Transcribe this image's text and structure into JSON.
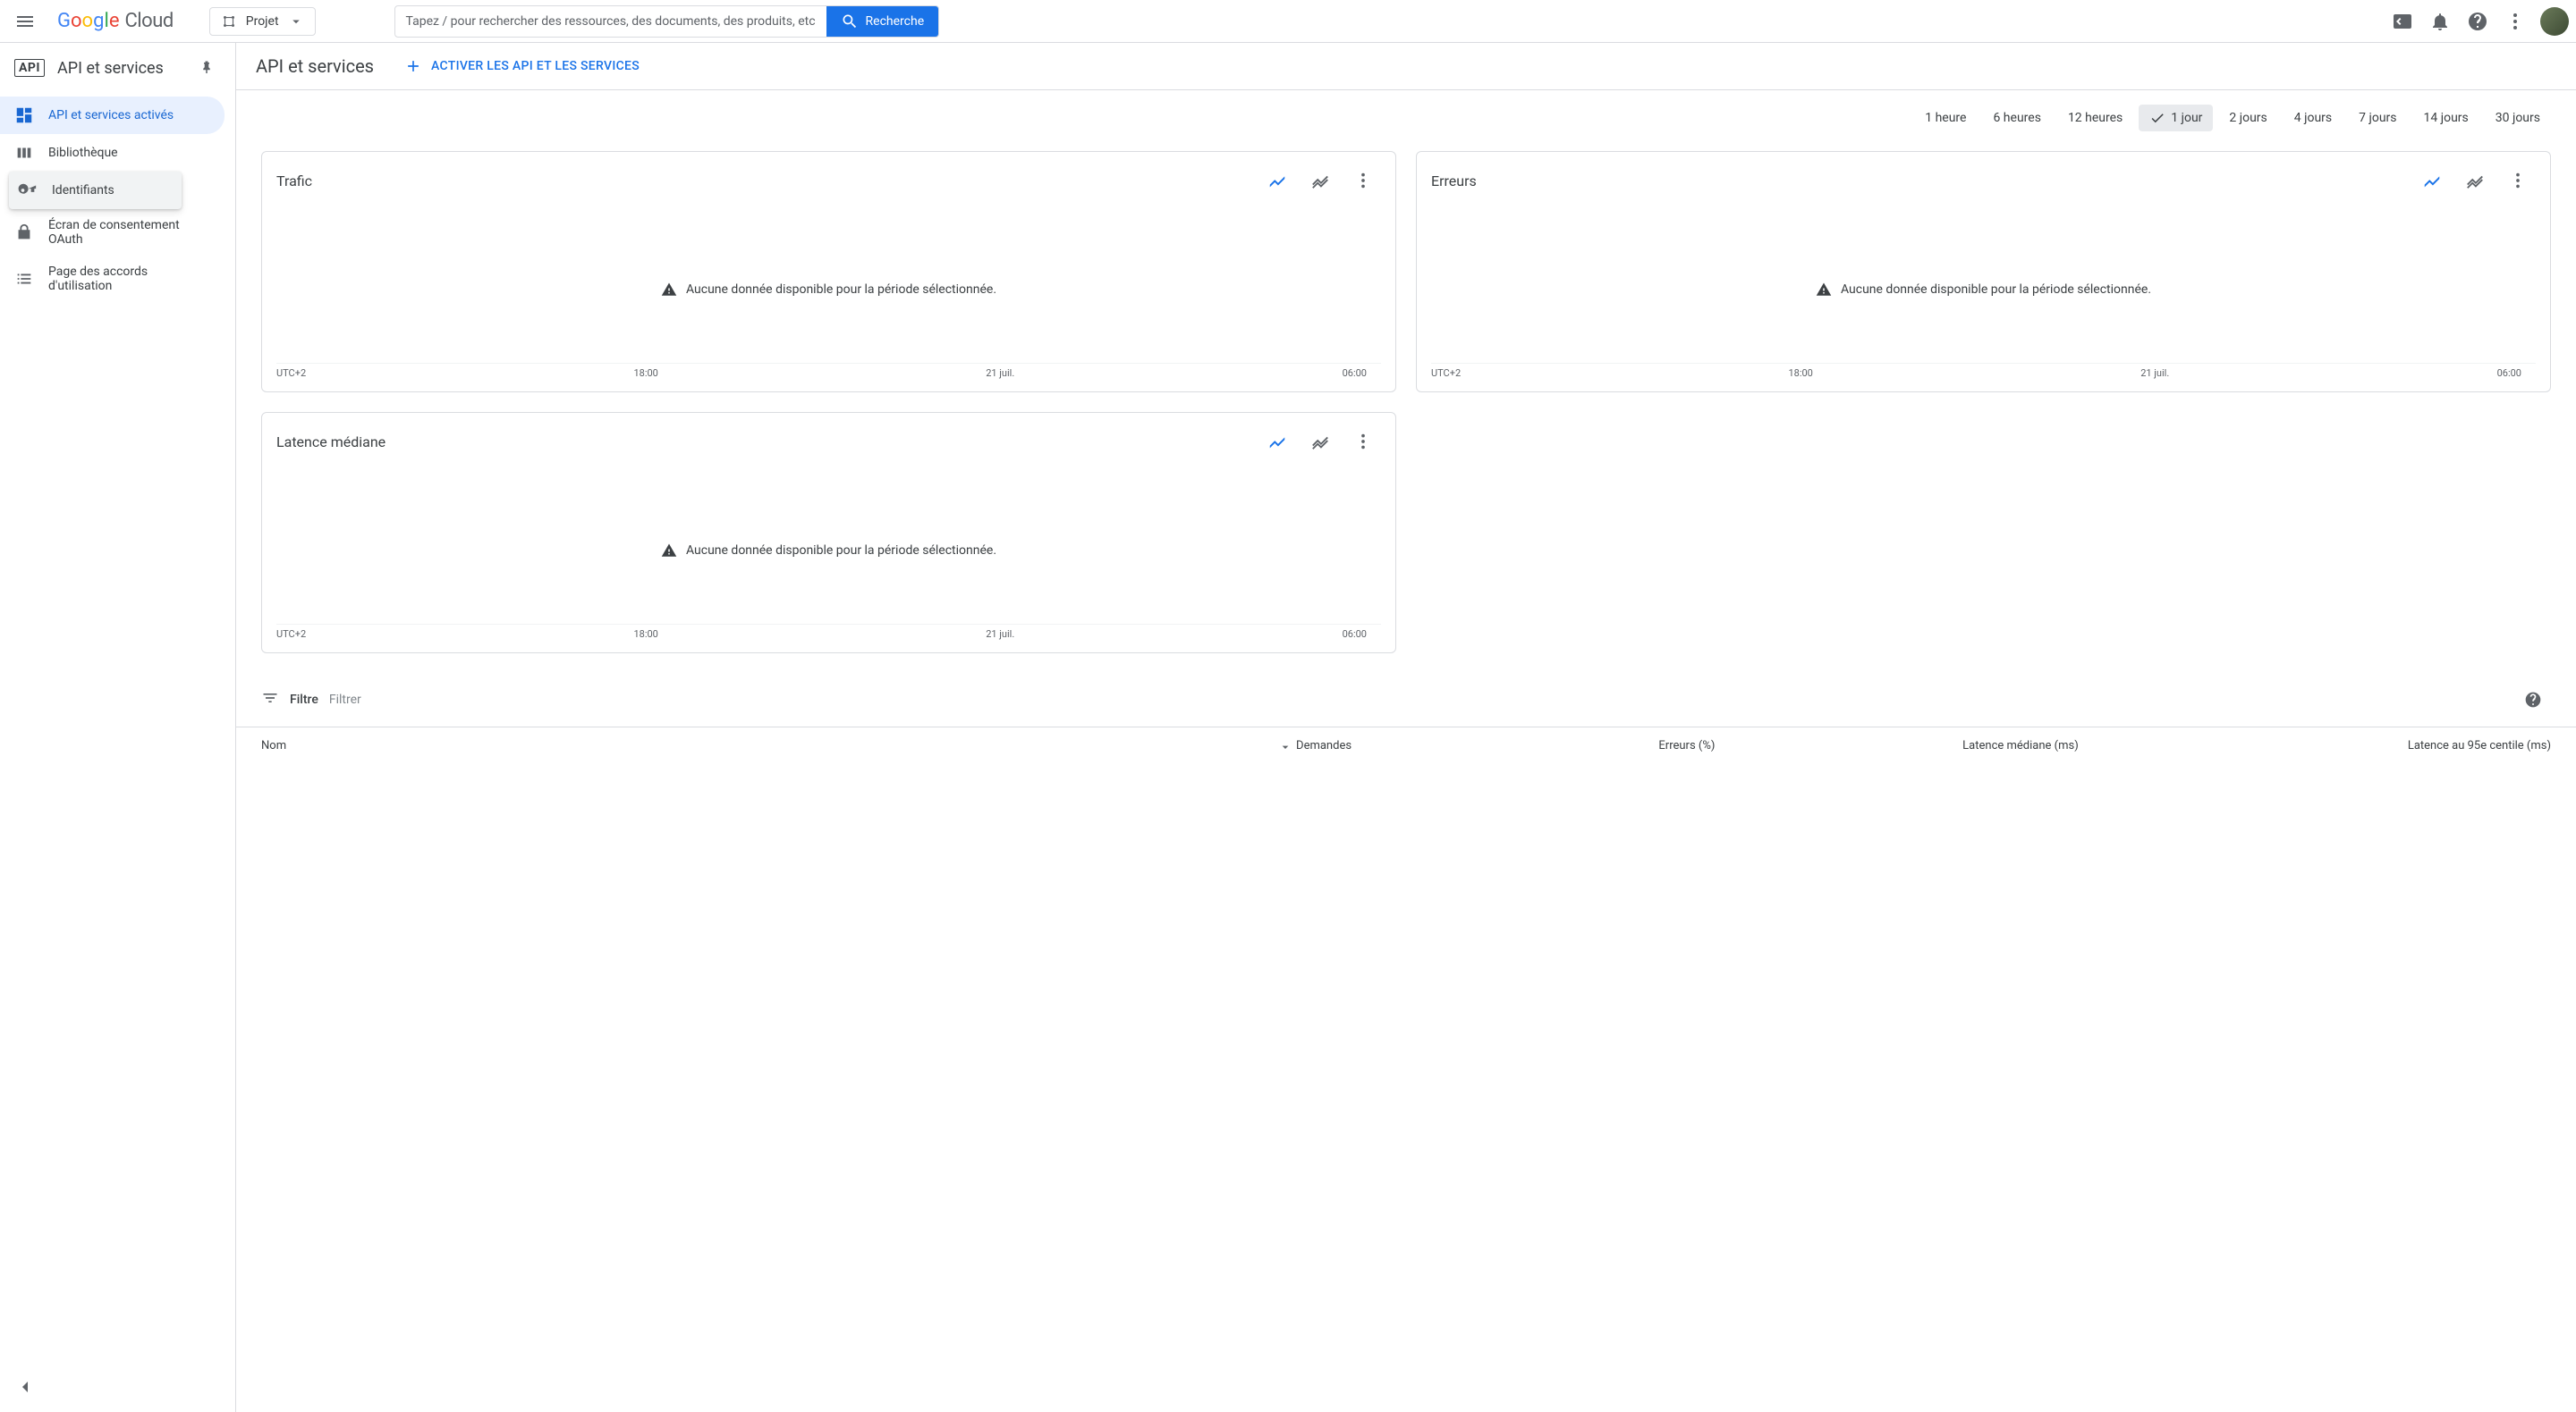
{
  "topbar": {
    "logo_cloud": "Cloud",
    "project_label": "Projet",
    "search_placeholder": "Tapez / pour rechercher des ressources, des documents, des produits, etc",
    "search_button": "Recherche"
  },
  "sidebar": {
    "product_title": "API et services",
    "items": [
      {
        "label": "API et services activés"
      },
      {
        "label": "Bibliothèque"
      },
      {
        "label": "Identifiants"
      },
      {
        "label": "Écran de consentement OAuth"
      },
      {
        "label": "Page des accords d'utilisation"
      }
    ]
  },
  "main": {
    "title": "API et services",
    "enable_button": "ACTIVER LES API ET LES SERVICES",
    "time_ranges": [
      "1 heure",
      "6 heures",
      "12 heures",
      "1 jour",
      "2 jours",
      "4 jours",
      "7 jours",
      "14 jours",
      "30 jours"
    ],
    "time_selected_index": 3,
    "no_data_msg": "Aucune donnée disponible pour la période sélectionnée.",
    "cards": [
      {
        "title": "Trafic"
      },
      {
        "title": "Erreurs"
      },
      {
        "title": "Latence médiane"
      }
    ],
    "axis_ticks": [
      "UTC+2",
      "18:00",
      "21 juil.",
      "06:00"
    ],
    "filter": {
      "label": "Filtre",
      "placeholder": "Filtrer"
    },
    "table_columns": [
      "Nom",
      "Demandes",
      "Erreurs (%)",
      "Latence médiane (ms)",
      "Latence au 95e centile (ms)"
    ]
  },
  "chart_data": [
    {
      "type": "line",
      "title": "Trafic",
      "x": [
        "UTC+2",
        "18:00",
        "21 juil.",
        "06:00"
      ],
      "series": [],
      "note": "Aucune donnée disponible pour la période sélectionnée."
    },
    {
      "type": "line",
      "title": "Erreurs",
      "x": [
        "UTC+2",
        "18:00",
        "21 juil.",
        "06:00"
      ],
      "series": [],
      "note": "Aucune donnée disponible pour la période sélectionnée."
    },
    {
      "type": "line",
      "title": "Latence médiane",
      "x": [
        "UTC+2",
        "18:00",
        "21 juil.",
        "06:00"
      ],
      "series": [],
      "note": "Aucune donnée disponible pour la période sélectionnée."
    }
  ]
}
